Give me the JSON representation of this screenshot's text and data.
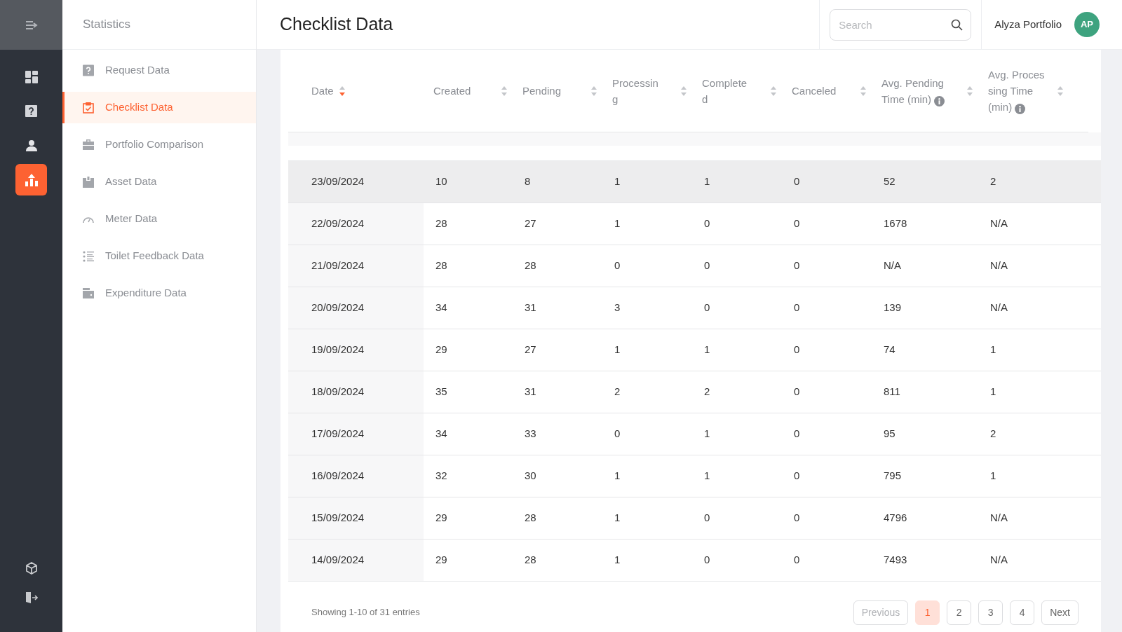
{
  "rail": {
    "items": [
      {
        "kind": "dashboard",
        "selected": false
      },
      {
        "kind": "question",
        "selected": false
      },
      {
        "kind": "person",
        "selected": false
      },
      {
        "kind": "chart",
        "selected": true
      }
    ]
  },
  "sidebar": {
    "title": "Statistics",
    "items": [
      {
        "label": "Request Data",
        "kind": "question",
        "selected": false
      },
      {
        "label": "Checklist Data",
        "kind": "checklist",
        "selected": true
      },
      {
        "label": "Portfolio Comparison",
        "kind": "briefcase",
        "selected": false
      },
      {
        "label": "Asset Data",
        "kind": "box",
        "selected": false
      },
      {
        "label": "Meter Data",
        "kind": "gauge",
        "selected": false
      },
      {
        "label": "Toilet Feedback Data",
        "kind": "list",
        "selected": false
      },
      {
        "label": "Expenditure Data",
        "kind": "wallet",
        "selected": false
      }
    ]
  },
  "header": {
    "title": "Checklist Data",
    "search": {
      "placeholder": "Search"
    },
    "user": {
      "name": "Alyza Portfolio",
      "initials": "AP"
    }
  },
  "table": {
    "columns": [
      {
        "label": "Date",
        "sorted": true,
        "info": false
      },
      {
        "label": "Created",
        "sorted": false,
        "info": false
      },
      {
        "label": "Pending",
        "sorted": false,
        "info": false
      },
      {
        "label": "Processing",
        "sorted": false,
        "info": false
      },
      {
        "label": "Completed",
        "sorted": false,
        "info": false
      },
      {
        "label": "Canceled",
        "sorted": false,
        "info": false
      },
      {
        "label": "Avg. Pending Time (min)",
        "sorted": false,
        "info": true
      },
      {
        "label": "Avg. Processing Time (min)",
        "sorted": false,
        "info": true
      }
    ],
    "rows": [
      {
        "highlighted": true,
        "cells": [
          "23/09/2024",
          "10",
          "8",
          "1",
          "1",
          "0",
          "52",
          "2"
        ]
      },
      {
        "highlighted": false,
        "cells": [
          "22/09/2024",
          "28",
          "27",
          "1",
          "0",
          "0",
          "1678",
          "N/A"
        ]
      },
      {
        "highlighted": false,
        "cells": [
          "21/09/2024",
          "28",
          "28",
          "0",
          "0",
          "0",
          "N/A",
          "N/A"
        ]
      },
      {
        "highlighted": false,
        "cells": [
          "20/09/2024",
          "34",
          "31",
          "3",
          "0",
          "0",
          "139",
          "N/A"
        ]
      },
      {
        "highlighted": false,
        "cells": [
          "19/09/2024",
          "29",
          "27",
          "1",
          "1",
          "0",
          "74",
          "1"
        ]
      },
      {
        "highlighted": false,
        "cells": [
          "18/09/2024",
          "35",
          "31",
          "2",
          "2",
          "0",
          "811",
          "1"
        ]
      },
      {
        "highlighted": false,
        "cells": [
          "17/09/2024",
          "34",
          "33",
          "0",
          "1",
          "0",
          "95",
          "2"
        ]
      },
      {
        "highlighted": false,
        "cells": [
          "16/09/2024",
          "32",
          "30",
          "1",
          "1",
          "0",
          "795",
          "1"
        ]
      },
      {
        "highlighted": false,
        "cells": [
          "15/09/2024",
          "29",
          "28",
          "1",
          "0",
          "0",
          "4796",
          "N/A"
        ]
      },
      {
        "highlighted": false,
        "cells": [
          "14/09/2024",
          "29",
          "28",
          "1",
          "0",
          "0",
          "7493",
          "N/A"
        ]
      }
    ]
  },
  "footer": {
    "summary": "Showing 1-10 of 31 entries",
    "previous": "Previous",
    "next": "Next",
    "pages": [
      {
        "label": "1",
        "selected": true
      },
      {
        "label": "2",
        "selected": false
      },
      {
        "label": "3",
        "selected": false
      },
      {
        "label": "4",
        "selected": false
      }
    ]
  }
}
